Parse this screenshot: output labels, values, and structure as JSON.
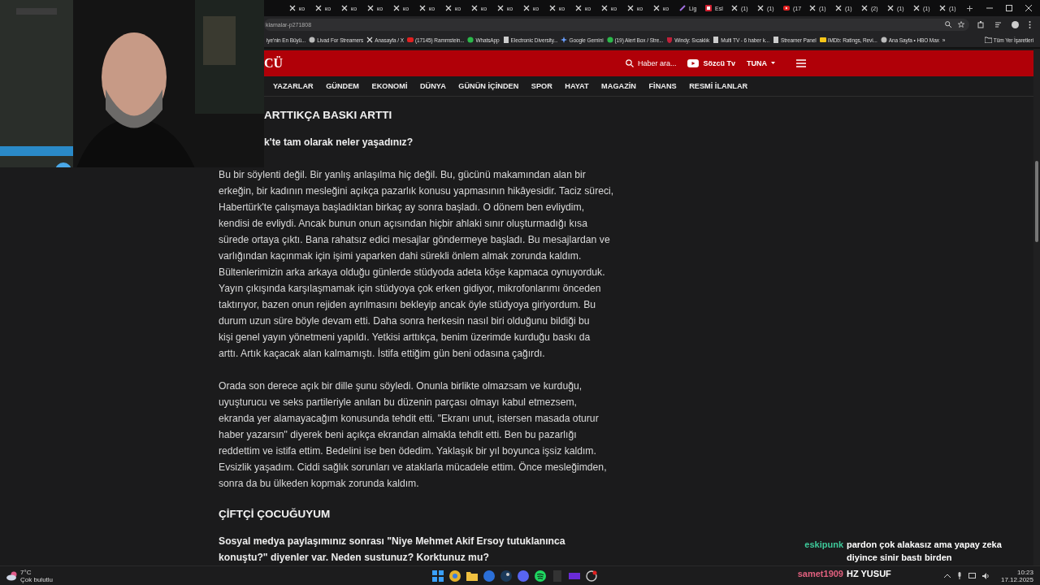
{
  "browser": {
    "tabs": [
      {
        "kind": "x",
        "title": "ко"
      },
      {
        "kind": "x",
        "title": "ко"
      },
      {
        "kind": "x",
        "title": "ко"
      },
      {
        "kind": "x",
        "title": "ко"
      },
      {
        "kind": "x",
        "title": "ко"
      },
      {
        "kind": "x",
        "title": "ко"
      },
      {
        "kind": "x",
        "title": "ко"
      },
      {
        "kind": "x",
        "title": "ко"
      },
      {
        "kind": "x",
        "title": "ко"
      },
      {
        "kind": "x",
        "title": "ко"
      },
      {
        "kind": "x",
        "title": "ко"
      },
      {
        "kind": "x",
        "title": "ко"
      },
      {
        "kind": "x",
        "title": "ко"
      },
      {
        "kind": "x",
        "title": "ко"
      },
      {
        "kind": "x",
        "title": "ко"
      },
      {
        "kind": "slash",
        "title": "Lig"
      },
      {
        "kind": "badge",
        "title": "Esl"
      },
      {
        "kind": "x",
        "title": "(1)"
      },
      {
        "kind": "x",
        "title": "(1)"
      },
      {
        "kind": "video",
        "title": "(17"
      },
      {
        "kind": "x",
        "title": "(1)"
      },
      {
        "kind": "x",
        "title": "(1)"
      },
      {
        "kind": "x",
        "title": "(2)"
      },
      {
        "kind": "x",
        "title": "(1)"
      },
      {
        "kind": "x",
        "title": "(1)"
      },
      {
        "kind": "x",
        "title": "(1)"
      }
    ],
    "address": "klamalar-p271808",
    "bookmarks": [
      {
        "kind": "none",
        "label": "iye'nin En Büyü..."
      },
      {
        "kind": "globe",
        "label": "Livad For Streamers"
      },
      {
        "kind": "x",
        "label": "Anasayfa / X"
      },
      {
        "kind": "video",
        "label": "(17145) Rammstein..."
      },
      {
        "kind": "chat",
        "label": "WhatsApp"
      },
      {
        "kind": "page",
        "label": "Electronic Diversity..."
      },
      {
        "kind": "spark",
        "label": "Google Gemini"
      },
      {
        "kind": "chat",
        "label": "(19) Alert Box / Stre..."
      },
      {
        "kind": "shield",
        "label": "Windy: Sıcaklık"
      },
      {
        "kind": "page",
        "label": "Multi TV - 6 haber k..."
      },
      {
        "kind": "page",
        "label": "Streamer Panel"
      },
      {
        "kind": "badge",
        "label": "IMDb: Ratings, Revi..."
      },
      {
        "kind": "globe",
        "label": "Ana Sayfa • HBO Max"
      }
    ],
    "more_bookmarks": "»",
    "all_bookmarks": "Tüm Yer İşaretleri"
  },
  "site": {
    "logo": "CÜ",
    "search_placeholder": "Haber ara...",
    "tv_link": "Sözcü Tv",
    "user": "TUNA",
    "nav": [
      "YAZARLAR",
      "GÜNDEM",
      "EKONOMİ",
      "DÜNYA",
      "GÜNÜN İÇİNDEN",
      "SPOR",
      "HAYAT",
      "MAGAZİN",
      "FİNANS",
      "RESMİ İLANLAR"
    ]
  },
  "article": [
    {
      "kind": "heading",
      "text": "ARTTIKÇA BASKI ARTTI"
    },
    {
      "kind": "question",
      "lines": [
        "k'te tam olarak neler yaşadınız?"
      ]
    },
    {
      "kind": "paragraph",
      "lines": [
        "Bu bir söylenti değil. Bir yanlış anlaşılma hiç değil. Bu, gücünü makamından alan bir",
        "erkeğin, bir kadının mesleğini açıkça pazarlık konusu yapmasının hikâyesidir. Taciz süreci,",
        "Habertürk'te çalışmaya başladıktan birkaç ay sonra başladı. O dönem ben evliydim,",
        "kendisi de evliydi. Ancak bunun onun açısından hiçbir ahlaki sınır oluşturmadığı kısa",
        "sürede ortaya çıktı. Bana rahatsız edici mesajlar göndermeye başladı. Bu mesajlardan ve",
        "varlığından kaçınmak için işimi yaparken dahi sürekli önlem almak zorunda kaldım.",
        "Bültenlerimizin arka arkaya olduğu günlerde stüdyoda adeta köşe kapmaca oynuyorduk.",
        "Yayın çıkışında karşılaşmamak için stüdyoya çok erken gidiyor, mikrofonlarımı önceden",
        "taktırıyor, bazen onun rejiden ayrılmasını bekleyip ancak öyle stüdyoya giriyordum. Bu",
        "durum uzun süre böyle devam etti. Daha sonra herkesin nasıl biri olduğunu bildiği bu",
        "kişi genel yayın yönetmeni yapıldı. Yetkisi arttıkça, benim üzerimde kurduğu baskı da",
        "arttı. Artık kaçacak alan kalmamıştı. İstifa ettiğim gün beni odasına çağırdı."
      ]
    },
    {
      "kind": "paragraph",
      "lines": [
        "Orada son derece açık bir dille şunu söyledi. Onunla birlikte olmazsam ve kurduğu,",
        "uyuşturucu ve seks partileriyle anılan bu düzenin parçası olmayı kabul etmezsem,",
        "ekranda yer alamayacağım konusunda tehdit etti. \"Ekranı unut, istersen masada oturur",
        "haber yazarsın\" diyerek beni açıkça ekrandan almakla tehdit etti. Ben bu pazarlığı",
        "reddettim ve istifa ettim. Bedelini ise ben ödedim. Yaklaşık bir yıl boyunca işsiz kaldım.",
        "Evsizlik yaşadım. Ciddi sağlık sorunları ve ataklarla mücadele ettim. Önce mesleğimden,",
        "sonra da bu ülkeden kopmak zorunda kaldım."
      ]
    },
    {
      "kind": "heading",
      "text": "ÇİFTÇİ ÇOCUĞUYUM"
    },
    {
      "kind": "question",
      "lines": [
        "Sosyal medya paylaşımınız sonrası \"Niye Mehmet Akif Ersoy tutuklanınca",
        "konuştu?\" diyenler var. Neden sustunuz? Korktunuz mu?"
      ]
    }
  ],
  "chat": [
    {
      "user": "eskipunk",
      "color": "#3ec99a",
      "message": "pardon çok alakasız ama yapay zeka diyince sinir bastı birden"
    },
    {
      "user": "samet1909",
      "color": "#e0607e",
      "message": "HZ YUSUF"
    }
  ],
  "taskbar": {
    "temperature": "7°C",
    "weather": "Çok bulutlu",
    "time": "10:23",
    "date": "17.12.2025"
  }
}
